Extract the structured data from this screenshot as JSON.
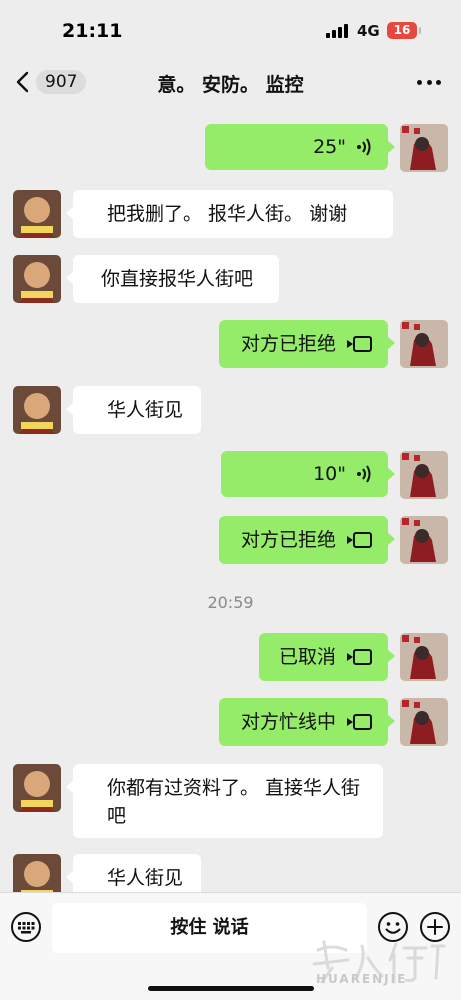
{
  "status_bar": {
    "time": "21:11",
    "network": "4G",
    "battery": "16",
    "battery_color": "#e8473d"
  },
  "header": {
    "back_icon": "chevron-left-icon",
    "unread_count": "907",
    "title": "意。 安防。 监控",
    "more_icon": "ellipsis-icon"
  },
  "colors": {
    "background": "#ededed",
    "outgoing_bubble": "#95ec69",
    "incoming_bubble": "#ffffff"
  },
  "messages": [
    {
      "side": "out",
      "type": "voice",
      "duration": "25\""
    },
    {
      "side": "in",
      "type": "text",
      "text": "把我删了。  报华人街。  谢谢"
    },
    {
      "side": "in",
      "type": "text",
      "text": "你直接报华人街吧"
    },
    {
      "side": "out",
      "type": "call",
      "text": "对方已拒绝"
    },
    {
      "side": "in",
      "type": "text",
      "text": "华人街见"
    },
    {
      "side": "out",
      "type": "voice",
      "duration": "10\""
    },
    {
      "side": "out",
      "type": "call",
      "text": "对方已拒绝"
    },
    {
      "side": "system",
      "type": "time",
      "text": "20:59"
    },
    {
      "side": "out",
      "type": "call",
      "text": "已取消"
    },
    {
      "side": "out",
      "type": "call",
      "text": "对方忙线中"
    },
    {
      "side": "in",
      "type": "text",
      "text": "你都有过资料了。  直接华人街吧"
    },
    {
      "side": "in",
      "type": "text",
      "text": "华人街见"
    }
  ],
  "input_bar": {
    "keyboard_icon": "keyboard-icon",
    "hold_to_talk": "按住 说话",
    "emoji_icon": "smiley-icon",
    "plus_icon": "plus-circle-icon"
  },
  "watermark": {
    "text": "HUARENJIE"
  }
}
